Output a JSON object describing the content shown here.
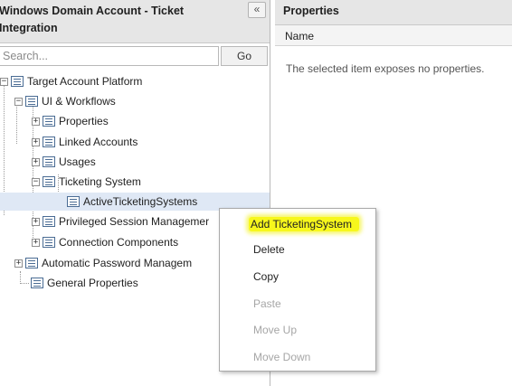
{
  "left": {
    "title": "Windows Domain Account - Ticket Integration",
    "collapse_label": "«",
    "search_placeholder": "Search...",
    "go_label": "Go"
  },
  "tree": {
    "nodes": [
      {
        "label": "Target Account Platform",
        "expander": "−"
      },
      {
        "label": "UI & Workflows",
        "expander": "−"
      },
      {
        "label": "Properties",
        "expander": "+"
      },
      {
        "label": "Linked Accounts",
        "expander": "+"
      },
      {
        "label": "Usages",
        "expander": "+"
      },
      {
        "label": "Ticketing System",
        "expander": "−"
      },
      {
        "label": "ActiveTicketingSystems",
        "expander": ""
      },
      {
        "label": "Privileged Session Managemer",
        "expander": "+"
      },
      {
        "label": "Connection Components",
        "expander": "+"
      },
      {
        "label": "Automatic Password Managem",
        "expander": "+"
      },
      {
        "label": "General Properties",
        "expander": ""
      }
    ]
  },
  "right": {
    "title": "Properties",
    "column_name": "Name",
    "empty_message": "The selected item exposes no properties."
  },
  "context_menu": {
    "items": [
      {
        "label": "Add TicketingSystem",
        "enabled": true,
        "highlighted": true
      },
      {
        "label": "Delete",
        "enabled": true
      },
      {
        "label": "Copy",
        "enabled": true
      },
      {
        "label": "Paste",
        "enabled": false
      },
      {
        "label": "Move Up",
        "enabled": false
      },
      {
        "label": "Move Down",
        "enabled": false
      }
    ]
  },
  "colors": {
    "highlight": "#f7f71c",
    "selected_row": "#dfe8f5",
    "header_bg": "#e6e6e6"
  }
}
